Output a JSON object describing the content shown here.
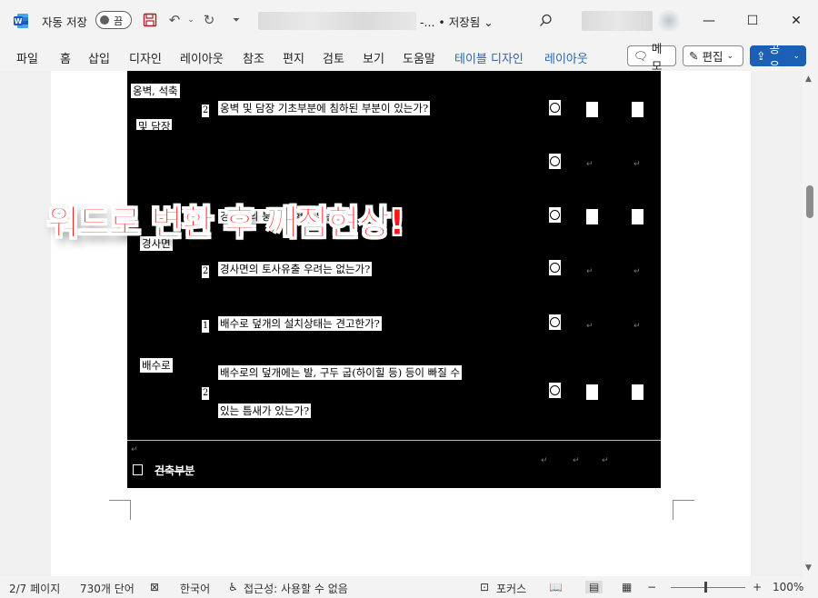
{
  "titlebar": {
    "autosave_label": "자동 저장",
    "toggle_state": "끔",
    "doc_title_suffix": "-... • 저장됨",
    "chevron": "⌄"
  },
  "ribbon": {
    "tabs": [
      "파일",
      "홈",
      "삽입",
      "디자인",
      "레이아웃",
      "참조",
      "편지",
      "검토",
      "보기",
      "도움말"
    ],
    "context_tabs": [
      "테이블 디자인",
      "레이아웃"
    ],
    "comment_label": "메모",
    "edit_label": "편집",
    "share_label": "공유"
  },
  "document": {
    "rows": [
      {
        "category": "옹벽, 석축",
        "category2": "및 담장",
        "num": "2",
        "question": "옹벽 및 담장 기초부분에 침하된 부분이 있는가?"
      },
      {
        "category": "",
        "num": "",
        "question": "...벽..."
      },
      {
        "category": "",
        "num": "1",
        "question": "경사면의 붕괴 위험은 없는가?"
      },
      {
        "category": "경사면",
        "num": "2",
        "question": "경사면의 토사유출 우려는 없는가?"
      },
      {
        "category": "",
        "num": "1",
        "question": "배수로 덮개의 설치상태는 견고한가?"
      },
      {
        "category": "배수로",
        "num": "2",
        "question": "배수로의 덮개에는 발, 구두 굽(하이힐 등) 등이 빠질 수",
        "question2": "있는 틈새가 있는가?"
      }
    ],
    "section_label": "건축부분",
    "return_mark": "↵"
  },
  "overlay_text": "워드로 변환 후 깨짐현상!",
  "status": {
    "page": "2/7 페이지",
    "words": "730개 단어",
    "language": "한국어",
    "accessibility": "접근성: 사용할 수 없음",
    "focus": "포커스",
    "zoom": "100%"
  }
}
